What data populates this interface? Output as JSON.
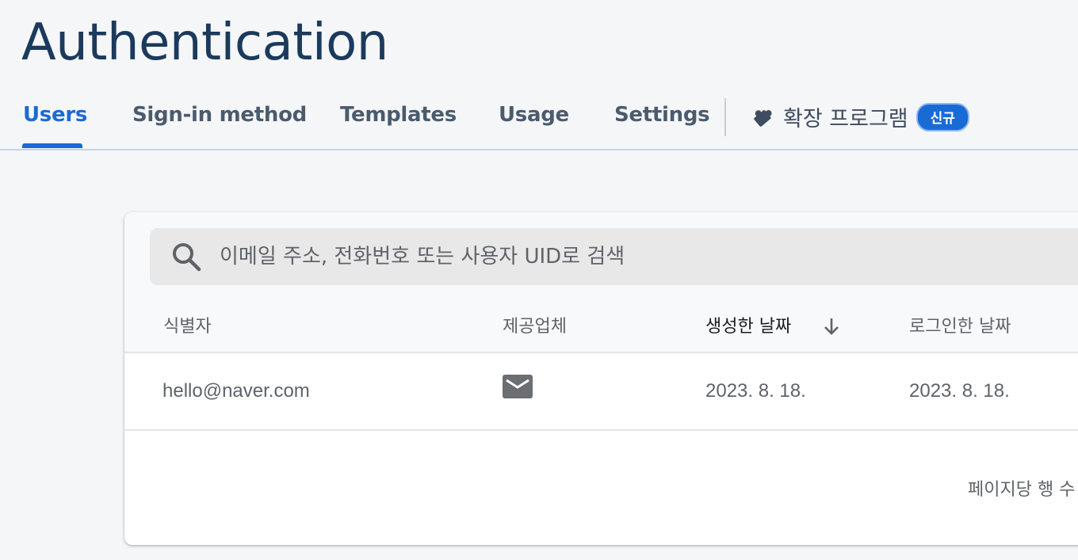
{
  "page": {
    "title": "Authentication"
  },
  "tabs": {
    "items": [
      {
        "label": "Users",
        "active": true
      },
      {
        "label": "Sign-in method"
      },
      {
        "label": "Templates"
      },
      {
        "label": "Usage"
      },
      {
        "label": "Settings"
      }
    ],
    "extensions": {
      "label": "확장 프로그램",
      "badge": "신규",
      "icon": "puzzle-icon"
    }
  },
  "search": {
    "placeholder": "이메일 주소, 전화번호 또는 사용자 UID로 검색",
    "value": "",
    "icon": "search-icon"
  },
  "table": {
    "columns": [
      {
        "label": "식별자"
      },
      {
        "label": "제공업체"
      },
      {
        "label": "생성한 날짜",
        "sorted": "desc"
      },
      {
        "label": "로그인한 날짜"
      }
    ],
    "rows": [
      {
        "identifier": "hello@naver.com",
        "provider_icon": "email-icon",
        "created": "2023. 8. 18.",
        "signed_in": "2023. 8. 18."
      }
    ]
  },
  "footer": {
    "rows_per_page_label": "페이지당 행 수"
  },
  "colors": {
    "accent": "#1a6ad6",
    "title": "#1b3a5c",
    "background": "#f5f6f8"
  }
}
